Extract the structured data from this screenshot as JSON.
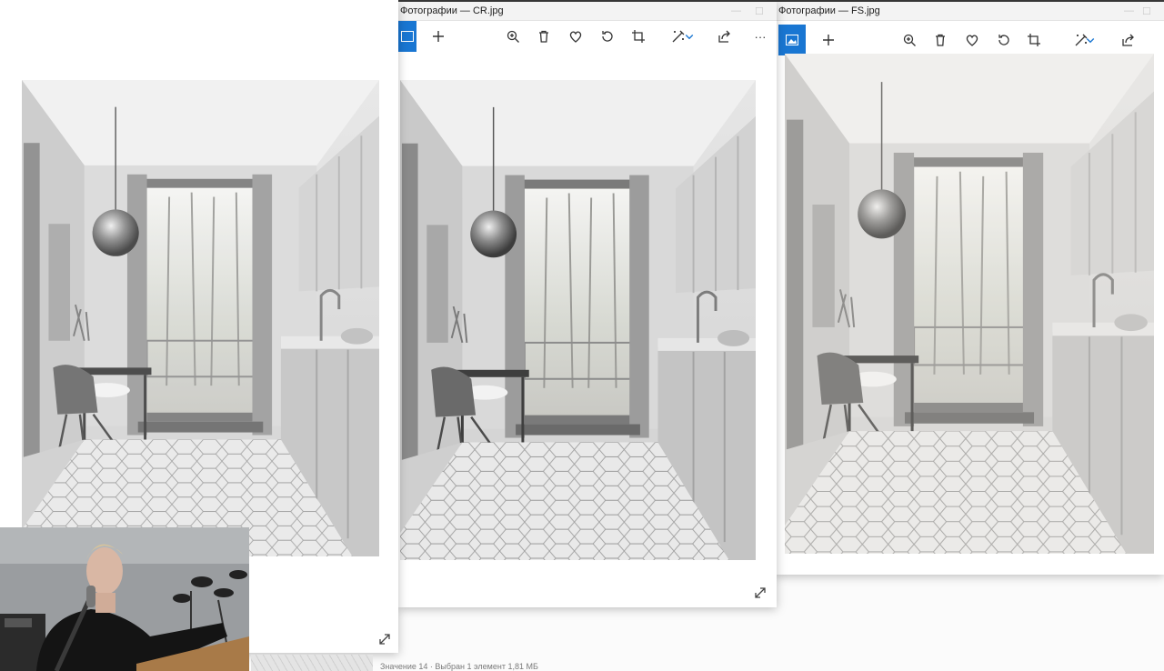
{
  "windows": [
    {
      "id": "w3",
      "title": "Фотографии — FS.jpg"
    },
    {
      "id": "w2",
      "title": "Фотографии — CR.jpg"
    },
    {
      "id": "w1",
      "title": ""
    }
  ],
  "toolbar": {
    "tools": [
      "add-icon",
      "zoom-icon",
      "delete-icon",
      "favorite-icon",
      "rotate-icon",
      "crop-icon",
      "edit-icon",
      "share-icon",
      "more-icon"
    ],
    "more_label": "···",
    "add_label": "+"
  },
  "statusbar": {
    "text": "Значение 14 · Выбран 1 элемент 1,81 МБ"
  },
  "colors": {
    "accent": "#1976d2",
    "window_bg": "#ffffff",
    "titlebar": "#f3f3f3"
  }
}
